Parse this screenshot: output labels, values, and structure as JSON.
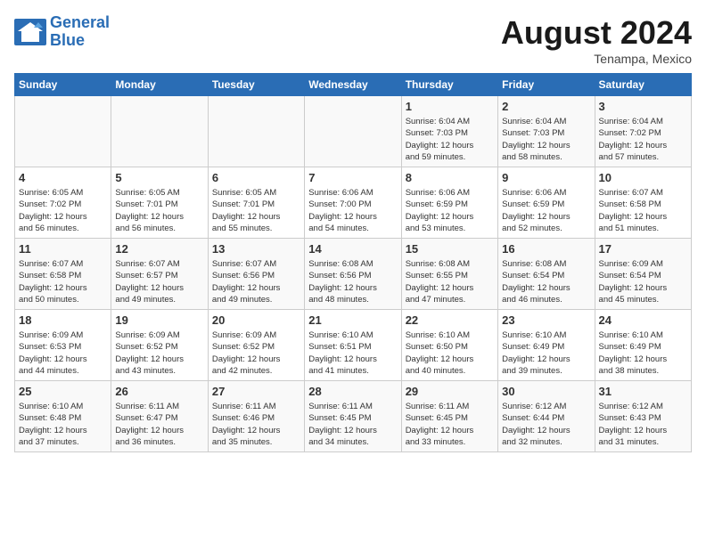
{
  "header": {
    "logo_line1": "General",
    "logo_line2": "Blue",
    "month_year": "August 2024",
    "location": "Tenampa, Mexico"
  },
  "weekdays": [
    "Sunday",
    "Monday",
    "Tuesday",
    "Wednesday",
    "Thursday",
    "Friday",
    "Saturday"
  ],
  "weeks": [
    [
      {
        "day": "",
        "info": ""
      },
      {
        "day": "",
        "info": ""
      },
      {
        "day": "",
        "info": ""
      },
      {
        "day": "",
        "info": ""
      },
      {
        "day": "1",
        "info": "Sunrise: 6:04 AM\nSunset: 7:03 PM\nDaylight: 12 hours\nand 59 minutes."
      },
      {
        "day": "2",
        "info": "Sunrise: 6:04 AM\nSunset: 7:03 PM\nDaylight: 12 hours\nand 58 minutes."
      },
      {
        "day": "3",
        "info": "Sunrise: 6:04 AM\nSunset: 7:02 PM\nDaylight: 12 hours\nand 57 minutes."
      }
    ],
    [
      {
        "day": "4",
        "info": "Sunrise: 6:05 AM\nSunset: 7:02 PM\nDaylight: 12 hours\nand 56 minutes."
      },
      {
        "day": "5",
        "info": "Sunrise: 6:05 AM\nSunset: 7:01 PM\nDaylight: 12 hours\nand 56 minutes."
      },
      {
        "day": "6",
        "info": "Sunrise: 6:05 AM\nSunset: 7:01 PM\nDaylight: 12 hours\nand 55 minutes."
      },
      {
        "day": "7",
        "info": "Sunrise: 6:06 AM\nSunset: 7:00 PM\nDaylight: 12 hours\nand 54 minutes."
      },
      {
        "day": "8",
        "info": "Sunrise: 6:06 AM\nSunset: 6:59 PM\nDaylight: 12 hours\nand 53 minutes."
      },
      {
        "day": "9",
        "info": "Sunrise: 6:06 AM\nSunset: 6:59 PM\nDaylight: 12 hours\nand 52 minutes."
      },
      {
        "day": "10",
        "info": "Sunrise: 6:07 AM\nSunset: 6:58 PM\nDaylight: 12 hours\nand 51 minutes."
      }
    ],
    [
      {
        "day": "11",
        "info": "Sunrise: 6:07 AM\nSunset: 6:58 PM\nDaylight: 12 hours\nand 50 minutes."
      },
      {
        "day": "12",
        "info": "Sunrise: 6:07 AM\nSunset: 6:57 PM\nDaylight: 12 hours\nand 49 minutes."
      },
      {
        "day": "13",
        "info": "Sunrise: 6:07 AM\nSunset: 6:56 PM\nDaylight: 12 hours\nand 49 minutes."
      },
      {
        "day": "14",
        "info": "Sunrise: 6:08 AM\nSunset: 6:56 PM\nDaylight: 12 hours\nand 48 minutes."
      },
      {
        "day": "15",
        "info": "Sunrise: 6:08 AM\nSunset: 6:55 PM\nDaylight: 12 hours\nand 47 minutes."
      },
      {
        "day": "16",
        "info": "Sunrise: 6:08 AM\nSunset: 6:54 PM\nDaylight: 12 hours\nand 46 minutes."
      },
      {
        "day": "17",
        "info": "Sunrise: 6:09 AM\nSunset: 6:54 PM\nDaylight: 12 hours\nand 45 minutes."
      }
    ],
    [
      {
        "day": "18",
        "info": "Sunrise: 6:09 AM\nSunset: 6:53 PM\nDaylight: 12 hours\nand 44 minutes."
      },
      {
        "day": "19",
        "info": "Sunrise: 6:09 AM\nSunset: 6:52 PM\nDaylight: 12 hours\nand 43 minutes."
      },
      {
        "day": "20",
        "info": "Sunrise: 6:09 AM\nSunset: 6:52 PM\nDaylight: 12 hours\nand 42 minutes."
      },
      {
        "day": "21",
        "info": "Sunrise: 6:10 AM\nSunset: 6:51 PM\nDaylight: 12 hours\nand 41 minutes."
      },
      {
        "day": "22",
        "info": "Sunrise: 6:10 AM\nSunset: 6:50 PM\nDaylight: 12 hours\nand 40 minutes."
      },
      {
        "day": "23",
        "info": "Sunrise: 6:10 AM\nSunset: 6:49 PM\nDaylight: 12 hours\nand 39 minutes."
      },
      {
        "day": "24",
        "info": "Sunrise: 6:10 AM\nSunset: 6:49 PM\nDaylight: 12 hours\nand 38 minutes."
      }
    ],
    [
      {
        "day": "25",
        "info": "Sunrise: 6:10 AM\nSunset: 6:48 PM\nDaylight: 12 hours\nand 37 minutes."
      },
      {
        "day": "26",
        "info": "Sunrise: 6:11 AM\nSunset: 6:47 PM\nDaylight: 12 hours\nand 36 minutes."
      },
      {
        "day": "27",
        "info": "Sunrise: 6:11 AM\nSunset: 6:46 PM\nDaylight: 12 hours\nand 35 minutes."
      },
      {
        "day": "28",
        "info": "Sunrise: 6:11 AM\nSunset: 6:45 PM\nDaylight: 12 hours\nand 34 minutes."
      },
      {
        "day": "29",
        "info": "Sunrise: 6:11 AM\nSunset: 6:45 PM\nDaylight: 12 hours\nand 33 minutes."
      },
      {
        "day": "30",
        "info": "Sunrise: 6:12 AM\nSunset: 6:44 PM\nDaylight: 12 hours\nand 32 minutes."
      },
      {
        "day": "31",
        "info": "Sunrise: 6:12 AM\nSunset: 6:43 PM\nDaylight: 12 hours\nand 31 minutes."
      }
    ]
  ]
}
